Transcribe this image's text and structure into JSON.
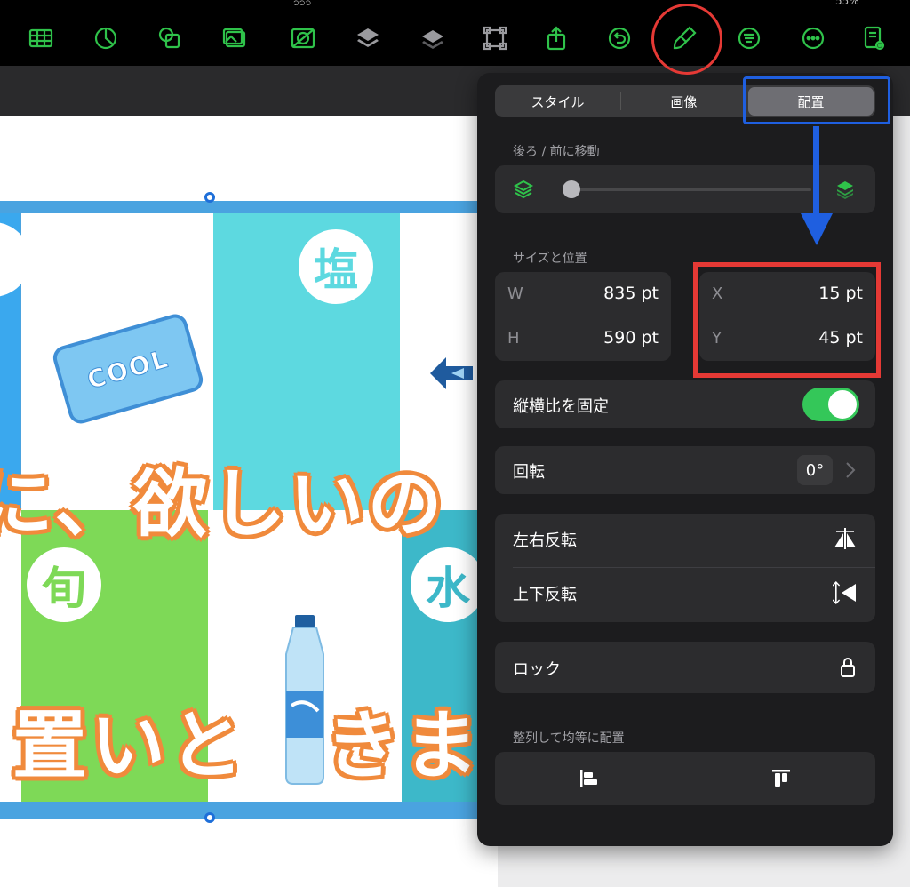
{
  "status_bar": {
    "left_fragment": "၁၁၁",
    "right_fragment": "55%"
  },
  "colors": {
    "toolbar_icon": "#2fc24a",
    "panel_bg": "#1c1c1e",
    "toggle_on": "#34c759",
    "annotation_red": "#e53935",
    "annotation_blue": "#1f5fe0"
  },
  "toolbar": {
    "icons": [
      "table-icon",
      "chart-icon",
      "shapes-icon",
      "media-icon",
      "image-gallery-icon",
      "layer-back-icon",
      "layer-front-icon",
      "crop-icon",
      "share-icon",
      "undo-icon",
      "format-brush-icon",
      "text-align-icon",
      "more-icon",
      "document-view-icon"
    ]
  },
  "slide": {
    "bubble_salt": "塩",
    "bubble_shun": "旬",
    "bubble_water": "水",
    "cool_label": "COOL",
    "line1": "に、欲しいの",
    "line2": "置いと　きま"
  },
  "panel": {
    "tabs": [
      {
        "label": "スタイル",
        "active": false
      },
      {
        "label": "画像",
        "active": false
      },
      {
        "label": "配置",
        "active": true
      }
    ],
    "move_section_label": "後ろ / 前に移動",
    "move_slider_level": 0.0,
    "size_section_label": "サイズと位置",
    "w_label": "W",
    "w_value": "835 pt",
    "h_label": "H",
    "h_value": "590 pt",
    "x_label": "X",
    "x_value": "15 pt",
    "y_label": "Y",
    "y_value": "45 pt",
    "lock_ratio_label": "縦横比を固定",
    "lock_ratio_on": true,
    "rotate_label": "回転",
    "rotate_value": "0°",
    "flip_h_label": "左右反転",
    "flip_v_label": "上下反転",
    "lock_label": "ロック",
    "align_section_label": "整列して均等に配置"
  }
}
